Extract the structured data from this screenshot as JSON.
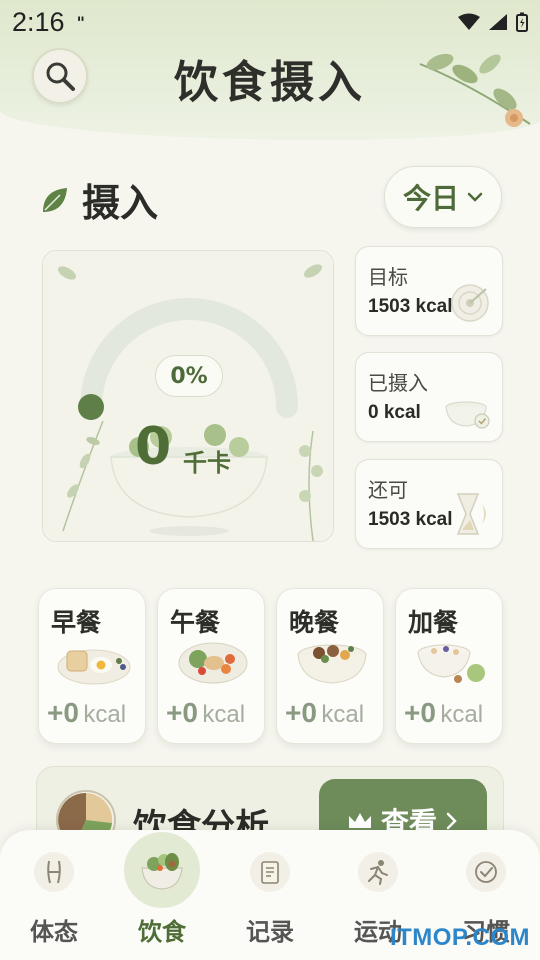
{
  "status_bar": {
    "time": "2:16",
    "indicator": "\""
  },
  "header": {
    "title": "饮食摄入"
  },
  "intake": {
    "section_title": "摄入",
    "period_selector": "今日",
    "progress_percent": "0%",
    "progress_fraction": 0,
    "consumed_value": "0",
    "consumed_unit": "千卡",
    "stats": [
      {
        "label": "目标",
        "value": "1503 kcal",
        "icon": "target-icon"
      },
      {
        "label": "已摄入",
        "value": "0 kcal",
        "icon": "bowl-icon"
      },
      {
        "label": "还可",
        "value": "1503 kcal",
        "icon": "hourglass-icon"
      }
    ]
  },
  "meals": [
    {
      "name": "早餐",
      "kcal": "+0",
      "unit": "kcal",
      "icon": "breakfast-icon"
    },
    {
      "name": "午餐",
      "kcal": "+0",
      "unit": "kcal",
      "icon": "lunch-icon"
    },
    {
      "name": "晚餐",
      "kcal": "+0",
      "unit": "kcal",
      "icon": "dinner-icon"
    },
    {
      "name": "加餐",
      "kcal": "+0",
      "unit": "kcal",
      "icon": "snack-icon"
    }
  ],
  "analysis": {
    "title": "饮食分析",
    "button_label": "查看"
  },
  "nav": [
    {
      "label": "体态",
      "icon": "body-icon",
      "active": false
    },
    {
      "label": "饮食",
      "icon": "food-bowl-icon",
      "active": true
    },
    {
      "label": "记录",
      "icon": "notebook-icon",
      "active": false
    },
    {
      "label": "运动",
      "icon": "runner-icon",
      "active": false
    },
    {
      "label": "习惯",
      "icon": "habit-check-icon",
      "active": false
    }
  ],
  "watermark": "ITMOP.COM",
  "colors": {
    "accent": "#4f6d37",
    "button": "#6e8c5a",
    "background": "#f6f6ef"
  }
}
